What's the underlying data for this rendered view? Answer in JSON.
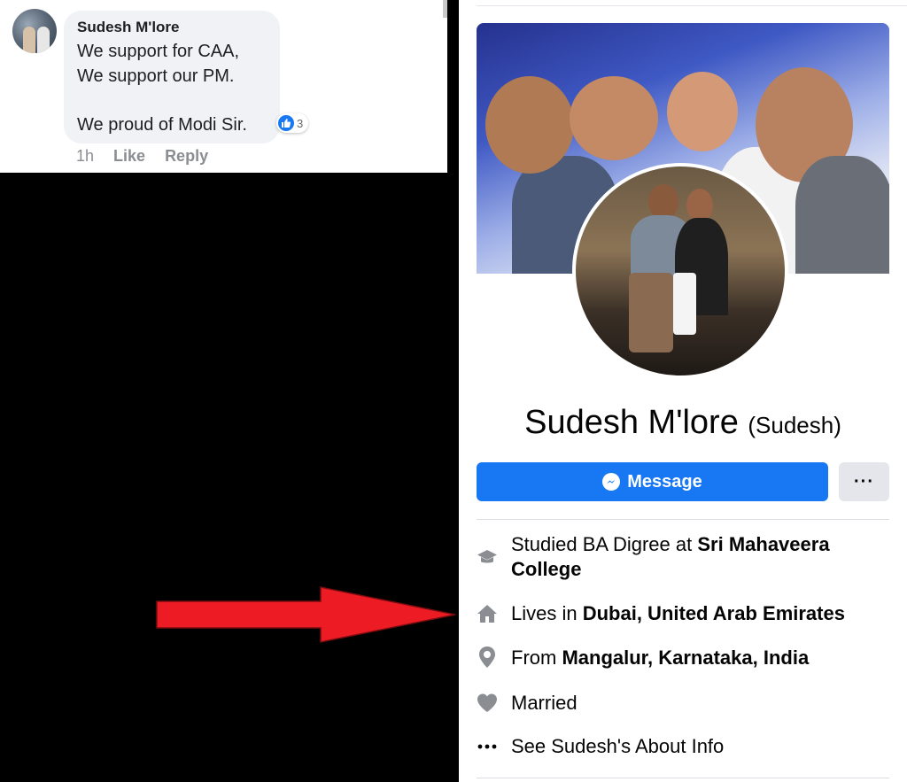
{
  "comment": {
    "author": "Sudesh M'lore",
    "lines": [
      "We support for CAA,",
      "We support our PM.",
      "",
      "We proud of Modi Sir."
    ],
    "reaction_count": "3",
    "time": "1h",
    "like_label": "Like",
    "reply_label": "Reply"
  },
  "profile": {
    "name": "Sudesh M'lore",
    "nickname": "(Sudesh)",
    "message_label": "Message",
    "more_label": "···",
    "info": {
      "education_prefix": "Studied BA Digree at ",
      "education_school_line1": "Sri Mahaveera",
      "education_school_line2": "College",
      "lives_prefix": "Lives in ",
      "lives_place": "Dubai, United Arab Emirates",
      "from_prefix": "From ",
      "from_place": "Mangalur, Karnataka, India",
      "relationship": "Married",
      "see_about": "See Sudesh's About Info"
    }
  },
  "colors": {
    "facebook_blue": "#1877f2",
    "arrow_red": "#ed1c24",
    "icon_gray": "#8a8d91"
  },
  "icons": [
    "like-icon",
    "messenger-icon",
    "graduation-cap-icon",
    "home-icon",
    "location-pin-icon",
    "heart-icon",
    "ellipsis-icon",
    "red-arrow"
  ]
}
